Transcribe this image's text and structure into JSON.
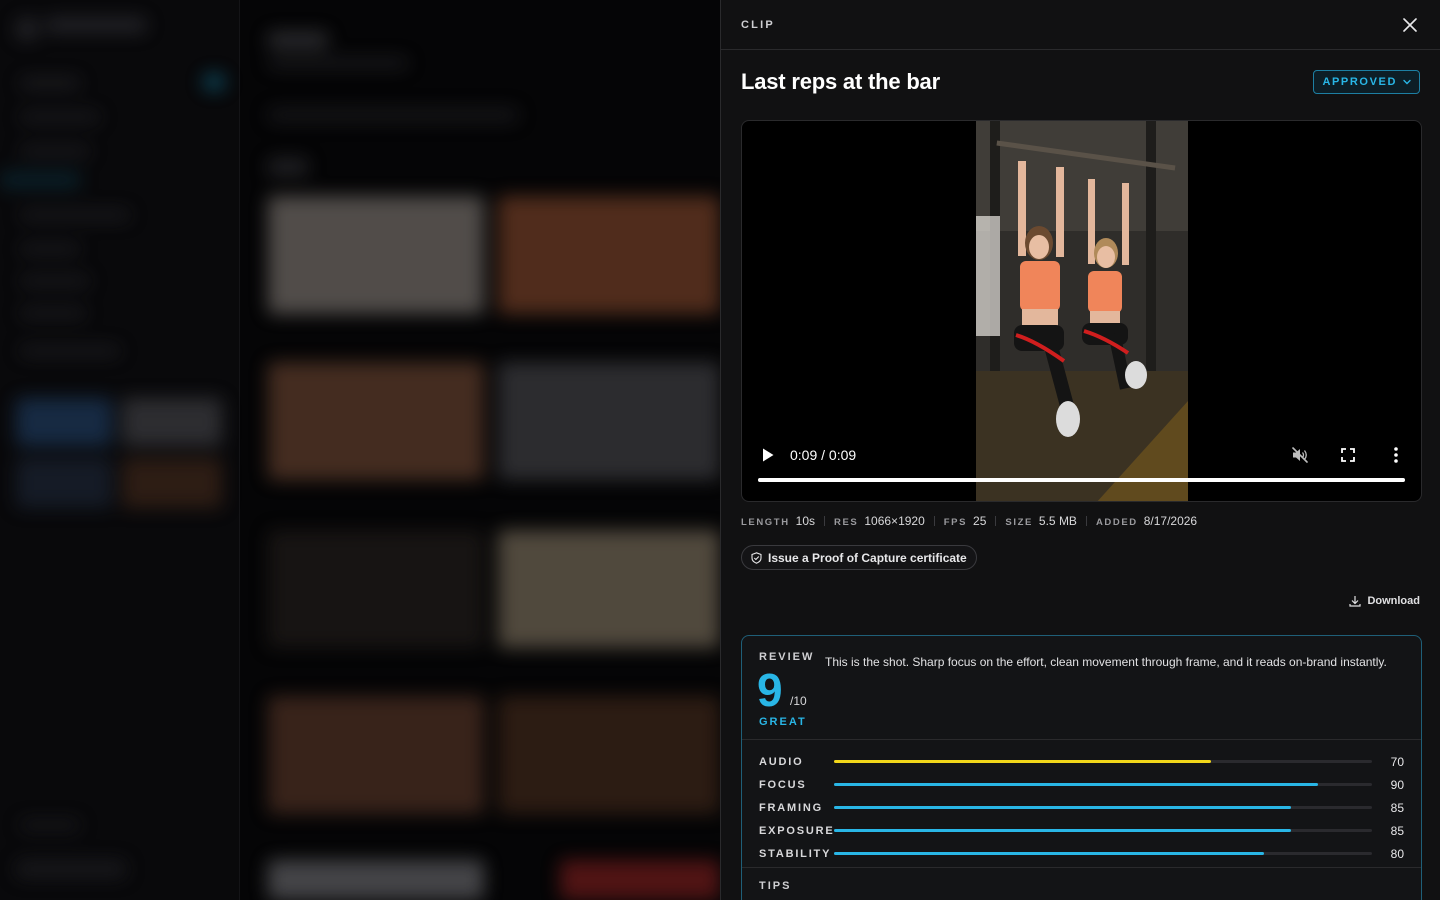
{
  "background_app": {
    "sidebar_badge": "",
    "note": ""
  },
  "panel": {
    "eyebrow": "CLIP",
    "title": "Last reps at the bar",
    "status": "APPROVED",
    "close_icon": "close-icon"
  },
  "video": {
    "time": "0:09 / 0:09",
    "progress": 1.0,
    "icons": [
      "play-icon",
      "mute-icon",
      "fullscreen-icon",
      "more-vertical-icon"
    ]
  },
  "meta": [
    {
      "key": "LENGTH",
      "value": "10s"
    },
    {
      "key": "RES",
      "value": "1066×1920"
    },
    {
      "key": "FPS",
      "value": "25"
    },
    {
      "key": "SIZE",
      "value": "5.5 MB"
    },
    {
      "key": "ADDED",
      "value": "8/17/2026"
    }
  ],
  "certificate_button": "Issue a Proof of Capture certificate",
  "download_button": "Download",
  "review": {
    "label": "REVIEW",
    "score": "9",
    "out_of": "/10",
    "grade": "GREAT",
    "comment": "This is the shot. Sharp focus on the effort, clean movement through frame, and it reads on-brand instantly.",
    "metrics": [
      {
        "name": "AUDIO",
        "value": 70,
        "color": "#f2d71a"
      },
      {
        "name": "FOCUS",
        "value": 90,
        "color": "#29b6e6"
      },
      {
        "name": "FRAMING",
        "value": 85,
        "color": "#29b6e6"
      },
      {
        "name": "EXPOSURE",
        "value": 85,
        "color": "#29b6e6"
      },
      {
        "name": "STABILITY",
        "value": 80,
        "color": "#29b6e6"
      }
    ],
    "tips_label": "TIPS"
  },
  "colors": {
    "accent": "#29b6e6",
    "warning": "#f2d71a",
    "panel_bg": "#111112"
  }
}
